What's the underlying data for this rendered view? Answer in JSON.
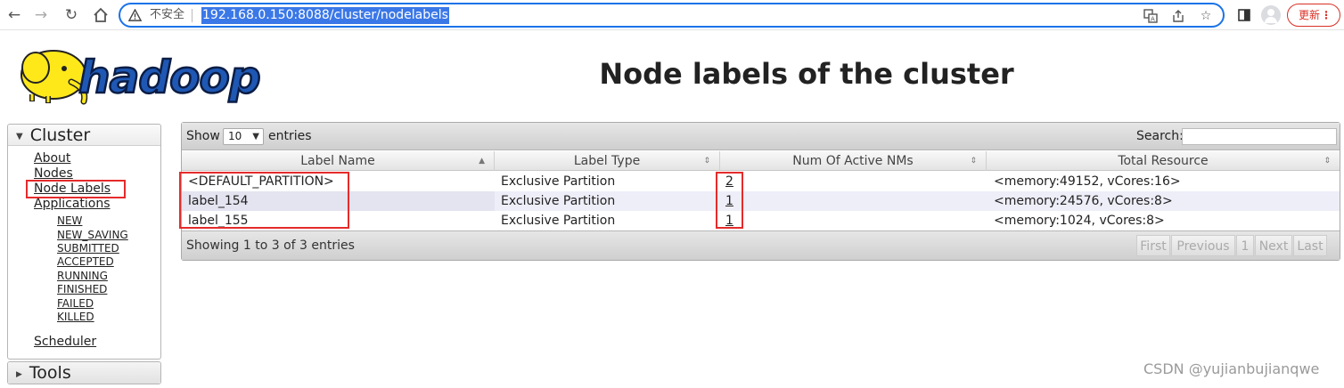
{
  "browser": {
    "insecure_label": "不安全",
    "url": "192.168.0.150:8088/cluster/nodelabels",
    "update_label": "更新"
  },
  "header": {
    "logo_text": "hadoop",
    "title": "Node labels of the cluster"
  },
  "sidebar": {
    "cluster_heading": "Cluster",
    "links": [
      "About",
      "Nodes",
      "Node Labels",
      "Applications"
    ],
    "app_states": [
      "NEW",
      "NEW_SAVING",
      "SUBMITTED",
      "ACCEPTED",
      "RUNNING",
      "FINISHED",
      "FAILED",
      "KILLED"
    ],
    "scheduler": "Scheduler",
    "tools_heading": "Tools"
  },
  "table": {
    "show_label": "Show",
    "page_size": "10",
    "entries_label": "entries",
    "search_label": "Search:",
    "columns": [
      "Label Name",
      "Label Type",
      "Num Of Active NMs",
      "Total Resource"
    ],
    "rows": [
      {
        "name": "<DEFAULT_PARTITION>",
        "type": "Exclusive Partition",
        "nms": "2",
        "resource": "<memory:49152, vCores:16>"
      },
      {
        "name": "label_154",
        "type": "Exclusive Partition",
        "nms": "1",
        "resource": "<memory:24576, vCores:8>"
      },
      {
        "name": "label_155",
        "type": "Exclusive Partition",
        "nms": "1",
        "resource": "<memory:1024, vCores:8>"
      }
    ],
    "info": "Showing 1 to 3 of 3 entries",
    "pager": [
      "First",
      "Previous",
      "1",
      "Next",
      "Last"
    ]
  },
  "watermark": "CSDN @yujianbujianqwe",
  "colors": {
    "accent": "#1a73e8",
    "highlight": "#e52b2b",
    "logo_yellow": "#ffe81a"
  }
}
